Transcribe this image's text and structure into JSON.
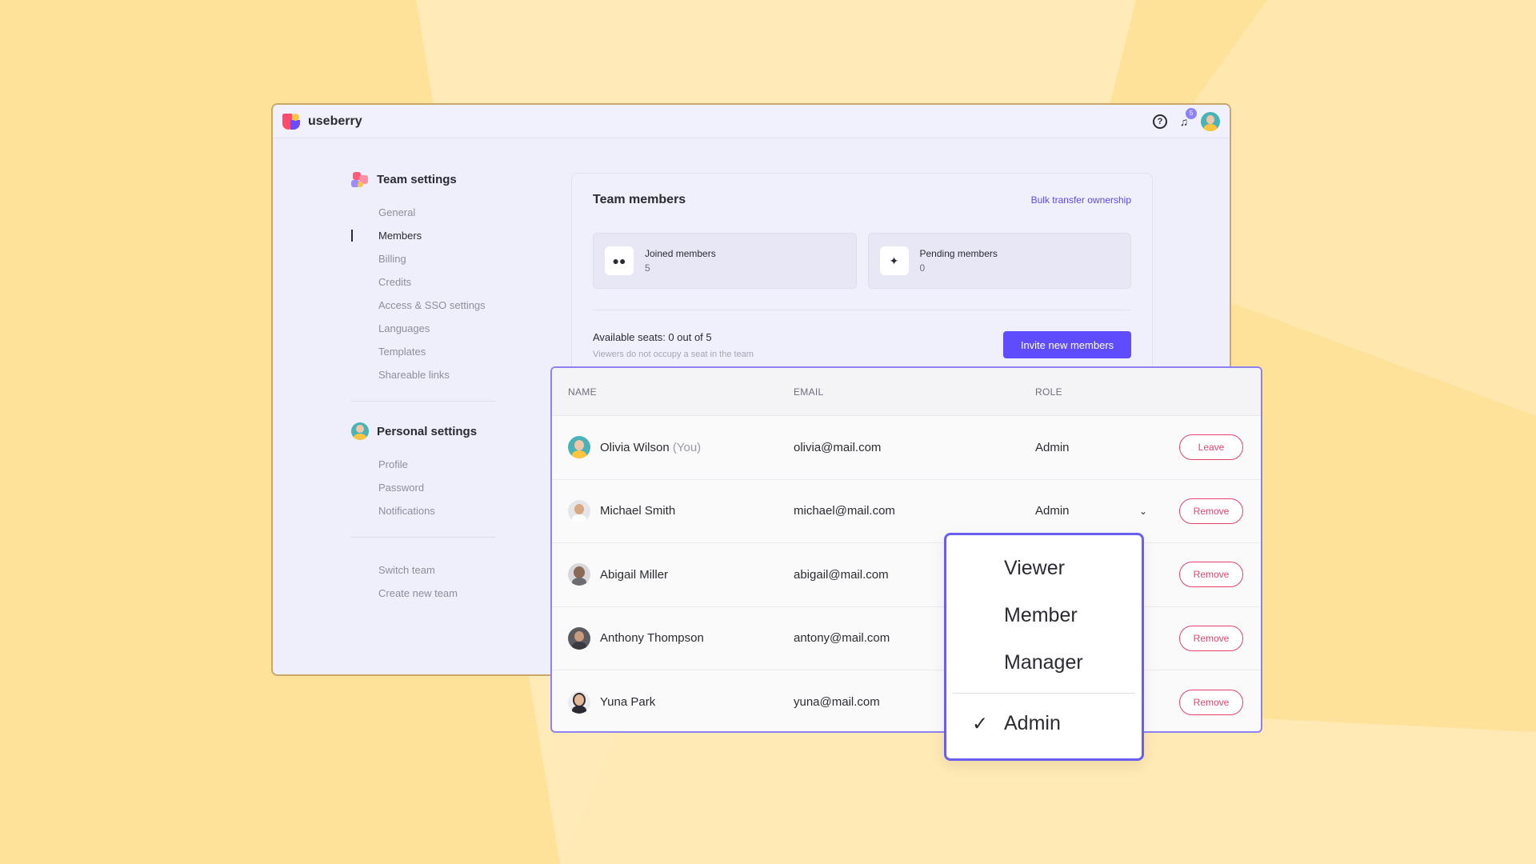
{
  "app": {
    "brand": "useberry",
    "notification_count": "5"
  },
  "sidebar": {
    "team_settings_title": "Team settings",
    "team_items": [
      {
        "label": "General"
      },
      {
        "label": "Members",
        "active": true
      },
      {
        "label": "Billing"
      },
      {
        "label": "Credits"
      },
      {
        "label": "Access & SSO settings"
      },
      {
        "label": "Languages"
      },
      {
        "label": "Templates"
      },
      {
        "label": "Shareable links"
      }
    ],
    "personal_settings_title": "Personal settings",
    "personal_items": [
      {
        "label": "Profile"
      },
      {
        "label": "Password"
      },
      {
        "label": "Notifications"
      }
    ],
    "team_actions": [
      {
        "label": "Switch team"
      },
      {
        "label": "Create new team"
      }
    ]
  },
  "team_card": {
    "title": "Team members",
    "bulk_link": "Bulk transfer ownership",
    "joined_label": "Joined members",
    "joined_value": "5",
    "pending_label": "Pending members",
    "pending_value": "0",
    "seats_text": "Available seats: 0 out of 5",
    "seats_sub": "Viewers do not occupy a seat in the team",
    "invite_label": "Invite new members"
  },
  "table": {
    "headers": {
      "name": "NAME",
      "email": "EMAIL",
      "role": "ROLE"
    },
    "rows": [
      {
        "name": "Olivia Wilson",
        "you": "(You)",
        "email": "olivia@mail.com",
        "role": "Admin",
        "action": "Leave"
      },
      {
        "name": "Michael Smith",
        "you": "",
        "email": "michael@mail.com",
        "role": "Admin",
        "action": "Remove"
      },
      {
        "name": "Abigail Miller",
        "you": "",
        "email": "abigail@mail.com",
        "role": "",
        "action": "Remove"
      },
      {
        "name": "Anthony Thompson",
        "you": "",
        "email": "antony@mail.com",
        "role": "",
        "action": "Remove"
      },
      {
        "name": "Yuna Park",
        "you": "",
        "email": "yuna@mail.com",
        "role": "",
        "action": "Remove"
      }
    ]
  },
  "role_dropdown": {
    "options": [
      "Viewer",
      "Member",
      "Manager"
    ],
    "selected": "Admin"
  },
  "colors": {
    "accent": "#5f4cff",
    "danger": "#e8436b",
    "background": "#ffe29a"
  }
}
